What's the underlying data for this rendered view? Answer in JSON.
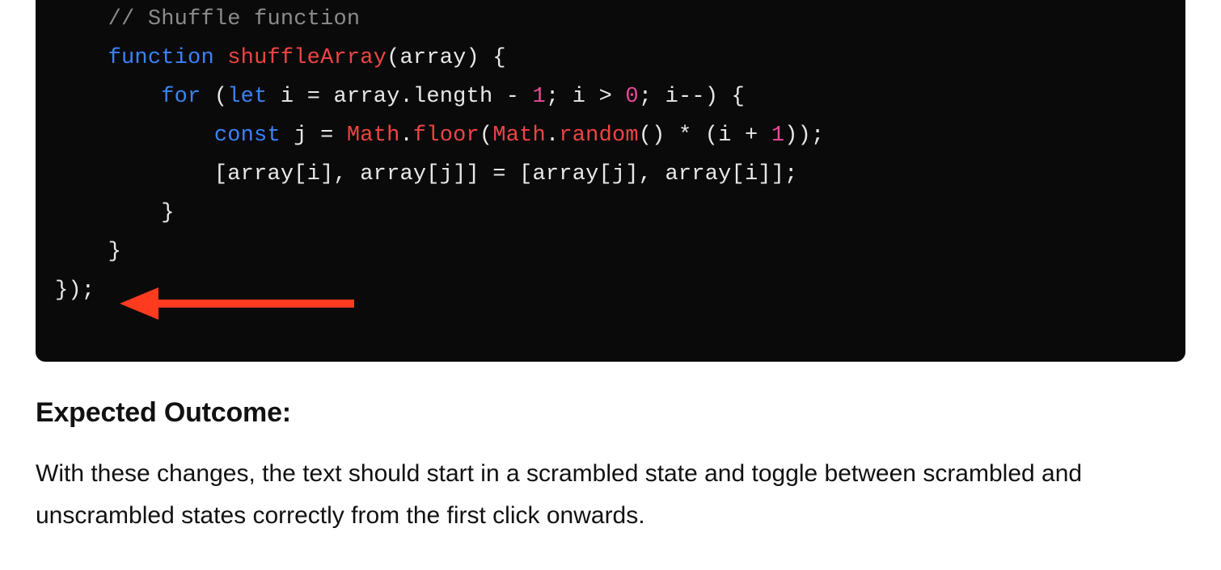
{
  "code": {
    "indent1": "    ",
    "indent2": "        ",
    "indent3": "            ",
    "comment": "// Shuffle function",
    "kw_function": "function",
    "fn_name": "shuffleArray",
    "fn_params": "(array) {",
    "kw_for": "for",
    "for_open": " (",
    "kw_let": "let",
    "for_var": " i ",
    "for_eq": "=",
    "for_init_rhs": " array.length ",
    "for_minus": "-",
    "num_1a": " 1",
    "for_semi1": "; ",
    "for_cond_lhs": "i ",
    "for_gt": ">",
    "num_0": " 0",
    "for_semi2": "; ",
    "for_step": "i--) {",
    "kw_const": "const",
    "const_lhs": " j ",
    "const_eq": "=",
    "math_obj": " Math",
    "dot1": ".",
    "floor": "floor",
    "floor_open": "(",
    "math_obj2": "Math",
    "dot2": ".",
    "random": "random",
    "random_call": "() ",
    "star": "*",
    "star_after": " (i ",
    "plus": "+",
    "num_1b": " 1",
    "rhs_close": "));",
    "swap_line": "[array[i], array[j]] = [array[j], array[i]];",
    "close_for": "}",
    "close_fn": "}",
    "close_outer": "});"
  },
  "prose": {
    "heading": "Expected Outcome:",
    "paragraph": "With these changes, the text should start in a scrambled state and toggle between scrambled and unscrambled states correctly from the first click onwards."
  },
  "arrow": {
    "color": "#ff3b1f"
  }
}
